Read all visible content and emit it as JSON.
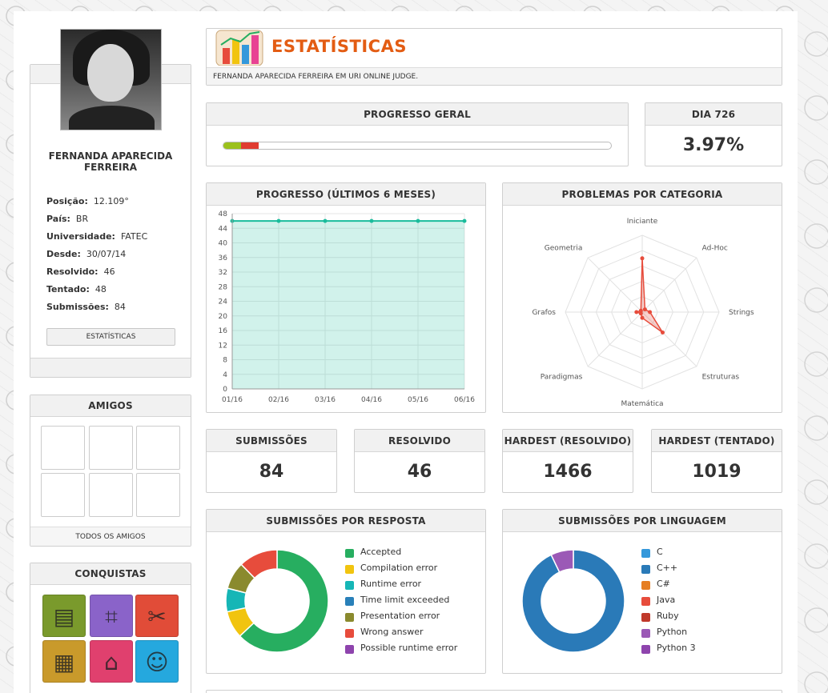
{
  "profile": {
    "name": "FERNANDA APARECIDA FERREIRA",
    "stats": [
      {
        "label": "Posição:",
        "value": "12.109°"
      },
      {
        "label": "País:",
        "value": "BR"
      },
      {
        "label": "Universidade:",
        "value": "FATEC"
      },
      {
        "label": "Desde:",
        "value": "30/07/14"
      },
      {
        "label": "Resolvido:",
        "value": "46"
      },
      {
        "label": "Tentado:",
        "value": "48"
      },
      {
        "label": "Submissões:",
        "value": "84"
      }
    ],
    "stats_button": "ESTATÍSTICAS"
  },
  "friends": {
    "title": "AMIGOS",
    "all_label": "TODOS OS AMIGOS"
  },
  "achievements": {
    "title": "CONQUISTAS",
    "badges": [
      {
        "icon": "document-icon",
        "color": "#7a9a2c"
      },
      {
        "icon": "gift-icon",
        "color": "#8a63c9"
      },
      {
        "icon": "tools-icon",
        "color": "#e14c38"
      },
      {
        "icon": "certificate-icon",
        "color": "#c99a2b"
      },
      {
        "icon": "graduation-cap-icon",
        "color": "#e0406e"
      },
      {
        "icon": "person-icon",
        "color": "#25a8de"
      }
    ]
  },
  "header": {
    "title": "ESTATÍSTICAS",
    "subtitle": "FERNANDA APARECIDA FERREIRA EM URI ONLINE JUDGE."
  },
  "overall_progress": {
    "title": "PROGRESSO GERAL",
    "solved_fraction": 0.046,
    "tried_fraction": 0.045
  },
  "day": {
    "title": "DIA 726",
    "value": "3.97%"
  },
  "progress_chart": {
    "title": "PROGRESSO (ÚLTIMOS 6 MESES)"
  },
  "category_chart": {
    "title": "PROBLEMAS POR CATEGORIA"
  },
  "counters": [
    {
      "title": "SUBMISSÕES",
      "value": "84"
    },
    {
      "title": "RESOLVIDO",
      "value": "46"
    },
    {
      "title": "HARDEST (RESOLVIDO)",
      "value": "1466"
    },
    {
      "title": "HARDEST (TENTADO)",
      "value": "1019"
    }
  ],
  "response_chart": {
    "title": "SUBMISSÕES POR RESPOSTA",
    "legend": [
      {
        "label": "Accepted",
        "color": "#27ae60"
      },
      {
        "label": "Compilation error",
        "color": "#f1c40f"
      },
      {
        "label": "Runtime error",
        "color": "#16b6b6"
      },
      {
        "label": "Time limit exceeded",
        "color": "#2980b9"
      },
      {
        "label": "Presentation error",
        "color": "#8a8a2e"
      },
      {
        "label": "Wrong answer",
        "color": "#e74c3c"
      },
      {
        "label": "Possible runtime error",
        "color": "#8e44ad"
      }
    ]
  },
  "language_chart": {
    "title": "SUBMISSÕES POR LINGUAGEM",
    "legend": [
      {
        "label": "C",
        "color": "#3498db"
      },
      {
        "label": "C++",
        "color": "#2a7ab8"
      },
      {
        "label": "C#",
        "color": "#e67e22"
      },
      {
        "label": "Java",
        "color": "#e74c3c"
      },
      {
        "label": "Ruby",
        "color": "#c0392b"
      },
      {
        "label": "Python",
        "color": "#9b59b6"
      },
      {
        "label": "Python 3",
        "color": "#8e44ad"
      }
    ]
  },
  "chart_data": [
    {
      "type": "area",
      "title": "PROGRESSO (ÚLTIMOS 6 MESES)",
      "categories": [
        "01/16",
        "02/16",
        "03/16",
        "04/16",
        "05/16",
        "06/16"
      ],
      "values": [
        46,
        46,
        46,
        46,
        46,
        46
      ],
      "ylim": [
        0,
        48
      ],
      "yticks": [
        0,
        4,
        8,
        12,
        16,
        20,
        24,
        28,
        32,
        36,
        40,
        44,
        48
      ],
      "grid": true,
      "color": "#1abc9c"
    },
    {
      "type": "radar",
      "title": "PROBLEMAS POR CATEGORIA",
      "categories": [
        "Iniciante",
        "Ad-Hoc",
        "Strings",
        "Estruturas",
        "Matemática",
        "Paradigmas",
        "Grafos",
        "Geometria"
      ],
      "values": [
        28,
        2,
        4,
        15,
        3,
        1,
        3,
        1
      ],
      "rmax": 40,
      "color": "#e74c3c"
    },
    {
      "type": "pie",
      "title": "SUBMISSÕES POR RESPOSTA",
      "labels": [
        "Accepted",
        "Compilation error",
        "Runtime error",
        "Time limit exceeded",
        "Presentation error",
        "Wrong answer",
        "Possible runtime error"
      ],
      "values": [
        51,
        7,
        6,
        0,
        7,
        10,
        0
      ]
    },
    {
      "type": "pie",
      "title": "SUBMISSÕES POR LINGUAGEM",
      "labels": [
        "C",
        "C++",
        "C#",
        "Java",
        "Ruby",
        "Python",
        "Python 3"
      ],
      "values": [
        0,
        78,
        0,
        0,
        0,
        6,
        0
      ]
    }
  ]
}
